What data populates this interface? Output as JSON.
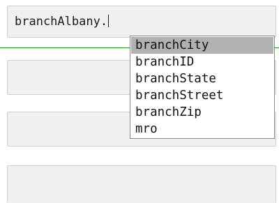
{
  "editor": {
    "input_value": "branchAlbany."
  },
  "autocomplete": {
    "selected_index": 0,
    "items": [
      {
        "label": "branchCity"
      },
      {
        "label": "branchID"
      },
      {
        "label": "branchState"
      },
      {
        "label": "branchStreet"
      },
      {
        "label": "branchZip"
      },
      {
        "label": "mro"
      }
    ]
  },
  "colors": {
    "field_background": "#f0f0f0",
    "field_border": "#cfcfcf",
    "focus_line": "#1f9a28",
    "selection_highlight": "#b1b1b1"
  }
}
